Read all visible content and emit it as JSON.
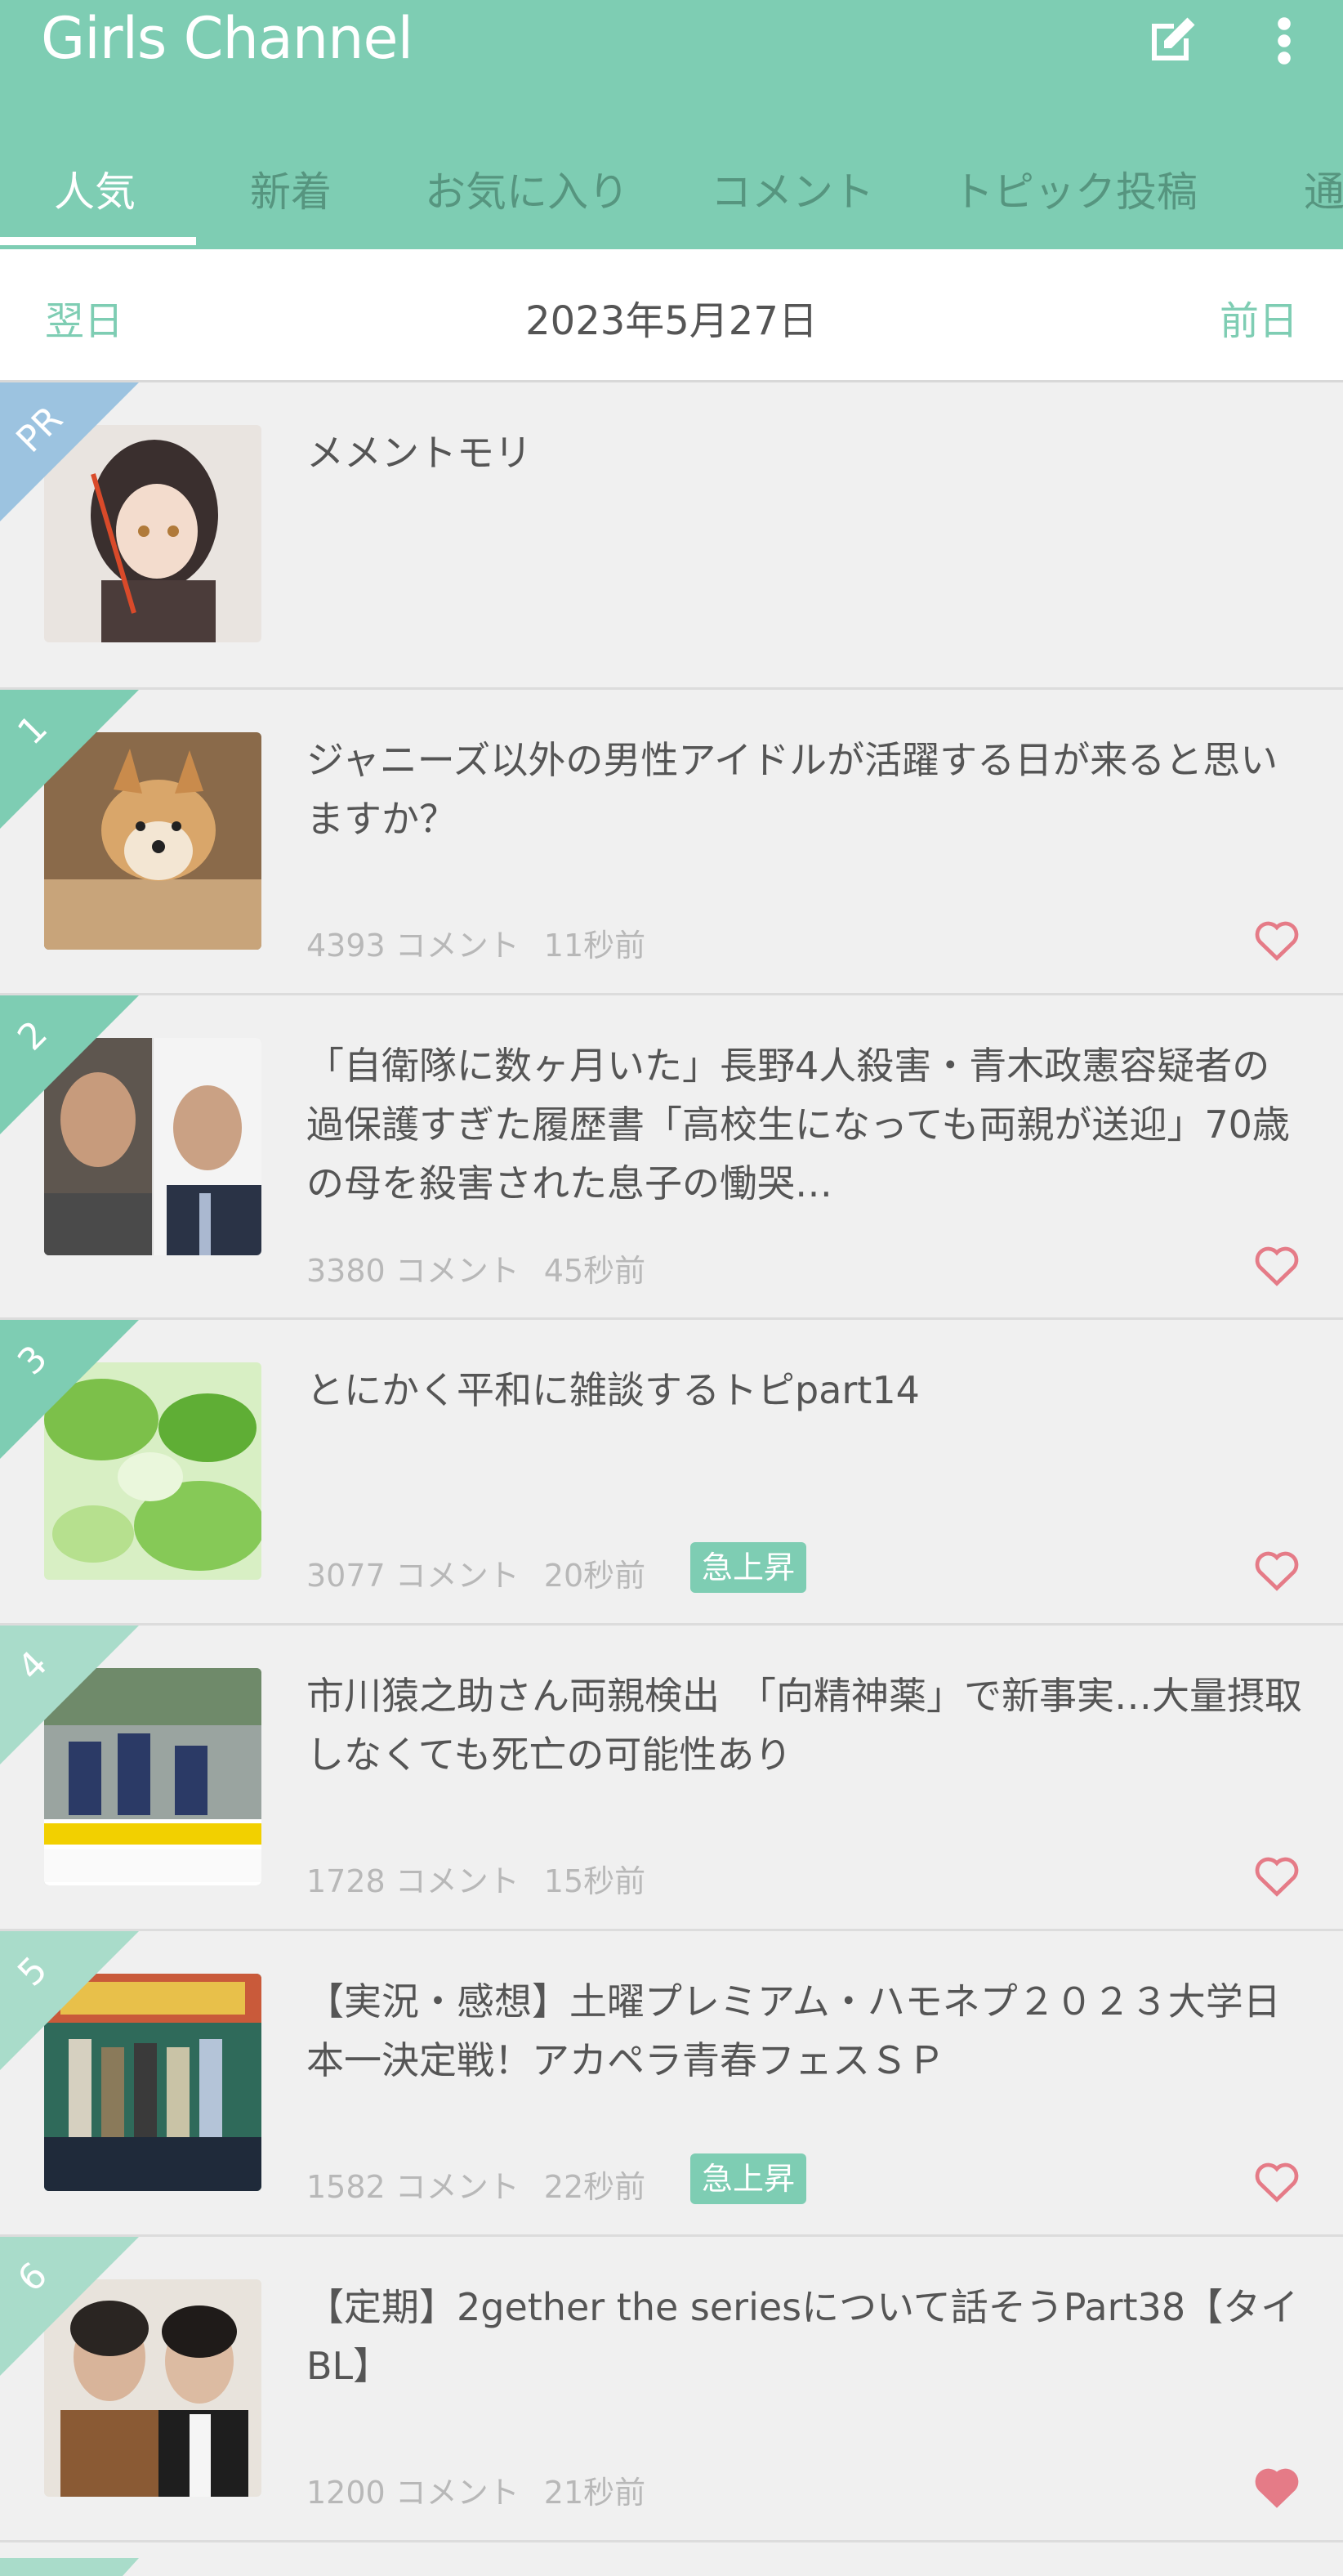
{
  "app": {
    "logo": "Girls Channel",
    "icons": {
      "compose": "edit-icon",
      "menu": "more-vert-icon"
    }
  },
  "tabs": [
    {
      "label": "人気",
      "active": true
    },
    {
      "label": "新着",
      "active": false
    },
    {
      "label": "お気に入り",
      "active": false
    },
    {
      "label": "コメント",
      "active": false
    },
    {
      "label": "トピック投稿",
      "active": false
    },
    {
      "label": "通",
      "active": false
    }
  ],
  "datebar": {
    "next_label": "翌日",
    "date": "2023年5月27日",
    "prev_label": "前日"
  },
  "colors": {
    "accent": "#7ecdb3",
    "pr_ribbon": "#9cc3e0",
    "heart": "#e57b87",
    "badge": "#7ecdb3"
  },
  "items": [
    {
      "rank": "PR",
      "title": "メメントモリ",
      "comments": "",
      "time": "",
      "badge": "",
      "favorited": false
    },
    {
      "rank": "1",
      "title": "ジャニーズ以外の男性アイドルが活躍する日が来ると思いますか？",
      "comments": "4393 コメント",
      "time": "11秒前",
      "badge": "",
      "favorited": false
    },
    {
      "rank": "2",
      "title": "「自衛隊に数ヶ月いた」長野4人殺害・青木政憲容疑者の過保護すぎた履歴書「高校生になっても両親が送迎」70歳の母を殺害された息子の慟哭…",
      "comments": "3380 コメント",
      "time": "45秒前",
      "badge": "",
      "favorited": false
    },
    {
      "rank": "3",
      "title": "とにかく平和に雑談するトピpart14",
      "comments": "3077 コメント",
      "time": "20秒前",
      "badge": "急上昇",
      "favorited": false
    },
    {
      "rank": "4",
      "title": "市川猿之助さん両親検出　「向精神薬」で新事実…大量摂取しなくても死亡の可能性あり",
      "comments": "1728 コメント",
      "time": "15秒前",
      "badge": "",
      "favorited": false
    },
    {
      "rank": "5",
      "title": "【実況・感想】土曜プレミアム・ハモネプ２０２３大学日本一決定戦！アカペラ青春フェスＳＰ",
      "comments": "1582 コメント",
      "time": "22秒前",
      "badge": "急上昇",
      "favorited": false
    },
    {
      "rank": "6",
      "title": "【定期】2gether the seriesについて話そうPart38【タイBL】",
      "comments": "1200 コメント",
      "time": "21秒前",
      "badge": "",
      "favorited": true
    }
  ]
}
